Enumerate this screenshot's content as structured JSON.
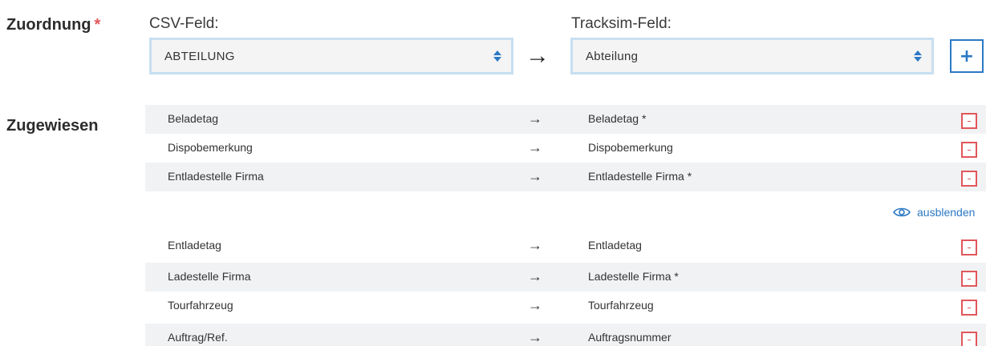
{
  "labels": {
    "zuordnung": "Zuordnung",
    "required_mark": "*",
    "zugewiesen": "Zugewiesen"
  },
  "headers": {
    "csv": "CSV-Feld:",
    "tracksim": "Tracksim-Feld:"
  },
  "selects": {
    "csv_value": "ABTEILUNG",
    "tracksim_value": "Abteilung"
  },
  "map_arrow": "→",
  "add_label": "+",
  "toggle_label": "ausblenden",
  "rows_top": [
    {
      "src": "Beladetag",
      "arrow": "→",
      "dst": "Beladetag *"
    },
    {
      "src": "Dispobemerkung",
      "arrow": "→",
      "dst": "Dispobemerkung"
    },
    {
      "src": "Entladestelle Firma",
      "arrow": "→",
      "dst": "Entladestelle Firma *"
    }
  ],
  "rows_bottom": [
    {
      "src": "Entladetag",
      "arrow": "→",
      "dst": "Entladetag"
    },
    {
      "src": "Ladestelle Firma",
      "arrow": "→",
      "dst": "Ladestelle Firma *"
    },
    {
      "src": "Tourfahrzeug",
      "arrow": "→",
      "dst": "Tourfahrzeug"
    },
    {
      "src": "Auftrag/Ref.",
      "arrow": "→",
      "dst": "Auftragsnummer"
    }
  ],
  "colors": {
    "accent": "#2b79c5",
    "required": "#e0575b",
    "select_border": "#c7dff1",
    "row_shade": "#f1f2f4"
  }
}
